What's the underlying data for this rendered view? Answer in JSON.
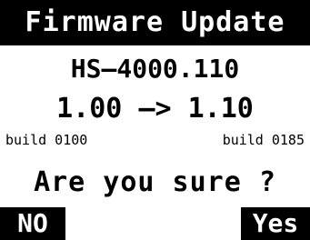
{
  "title": "Firmware Update",
  "model": "HS—4000.110",
  "versions": {
    "from": "1.00",
    "arrow": "—>",
    "to": "1.10"
  },
  "builds": {
    "current": "build 0100",
    "new": "build 0185"
  },
  "prompt": "Are you sure ?",
  "buttons": {
    "no": "NO",
    "yes": "Yes"
  },
  "colors": {
    "background": "#ffffff",
    "foreground": "#000000"
  }
}
